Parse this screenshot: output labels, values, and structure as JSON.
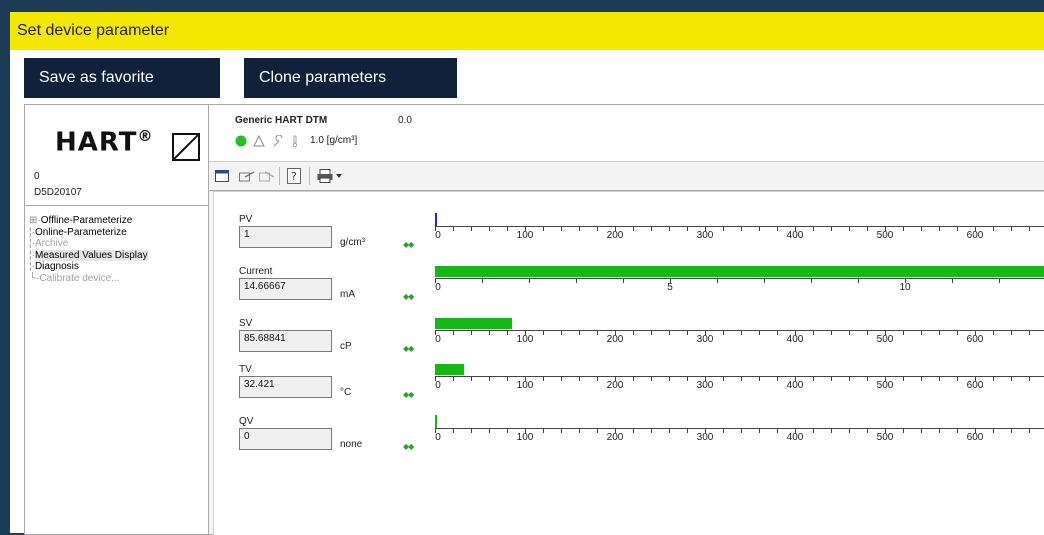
{
  "window": {
    "title": "Set device parameter"
  },
  "toolbar_buttons": {
    "save_favorite": "Save as favorite",
    "clone_parameters": "Clone parameters"
  },
  "device_panel": {
    "logo_text": "HART",
    "logo_reg": "®",
    "address": "0",
    "serial": "D5D20107"
  },
  "tree": {
    "items": [
      {
        "label": "Offline-Parameterize",
        "expander": "⊞"
      },
      {
        "label": "Online-Parameterize"
      },
      {
        "label": "Archive"
      },
      {
        "label": "Measured Values Display"
      },
      {
        "label": "Diagnosis"
      },
      {
        "label": "Calibrate device..."
      }
    ]
  },
  "dtm_header": {
    "title": "Generic HART DTM",
    "version": "0.0",
    "primary_value_display": "1.0 [g/cm³]",
    "status_color": "#22c022"
  },
  "measured_values": [
    {
      "label": "PV",
      "value": "1",
      "unit": "g/cm³",
      "bar_value": 1,
      "scale_max": 680,
      "marker_color": "#1f2fb0",
      "ticks": [
        "0",
        "100",
        "200",
        "300",
        "400",
        "500",
        "600"
      ]
    },
    {
      "label": "Current",
      "value": "14.66667",
      "unit": "mA",
      "bar_value": 14.66667,
      "scale_max": 14.66667,
      "marker_color": "#15b815",
      "ticks": [
        "0",
        "5",
        "10"
      ]
    },
    {
      "label": "SV",
      "value": "85.68841",
      "unit": "cP",
      "bar_value": 85.68841,
      "scale_max": 680,
      "marker_color": "#15b815",
      "ticks": [
        "0",
        "100",
        "200",
        "300",
        "400",
        "500",
        "600"
      ]
    },
    {
      "label": "TV",
      "value": "32.421",
      "unit": "°C",
      "bar_value": 32.421,
      "scale_max": 680,
      "marker_color": "#15b815",
      "ticks": [
        "0",
        "100",
        "200",
        "300",
        "400",
        "500",
        "600"
      ]
    },
    {
      "label": "QV",
      "value": "0",
      "unit": "none",
      "bar_value": 0,
      "scale_max": 680,
      "marker_color": "#15b815",
      "ticks": [
        "0",
        "100",
        "200",
        "300",
        "400",
        "500",
        "600"
      ]
    }
  ],
  "colors": {
    "title_bar": "#f5e800",
    "button_bg": "#12213a",
    "bar_green": "#15b815"
  }
}
